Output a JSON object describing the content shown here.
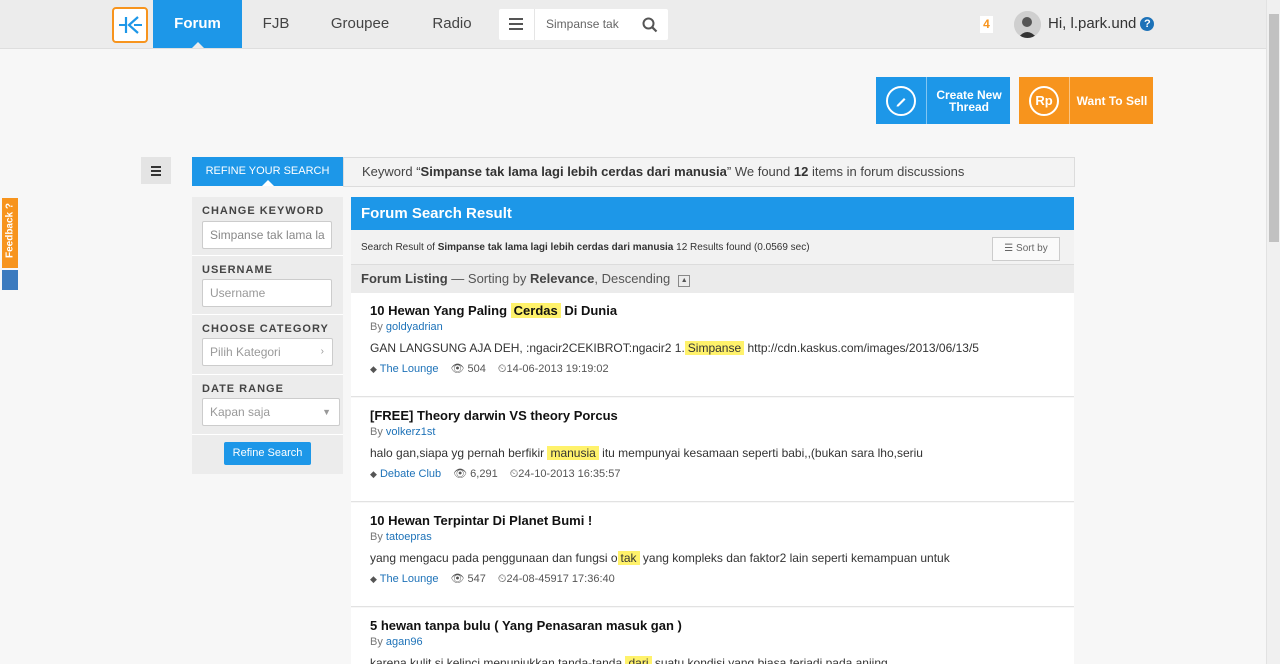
{
  "nav": {
    "tabs": [
      {
        "label": "Forum"
      },
      {
        "label": "FJB"
      },
      {
        "label": "Groupee"
      },
      {
        "label": "Radio"
      }
    ],
    "search_value": "Simpanse tak",
    "notification_count": "4",
    "greeting": "Hi, l.park.und"
  },
  "feedback": {
    "label": "Feedback ?"
  },
  "actions": {
    "create_thread": "Create New Thread",
    "want_to_sell": "Want To Sell",
    "sell_icon_text": "Rp"
  },
  "refine": {
    "tab_label": "REFINE YOUR SEARCH",
    "keyword_prefix": "Keyword “",
    "keyword": "Simpanse tak lama lagi lebih cerdas dari manusia",
    "keyword_mid": "” We found ",
    "count": "12",
    "keyword_suffix": " items in forum discussions"
  },
  "sidebar": {
    "change_keyword_label": "CHANGE KEYWORD",
    "change_keyword_value": "Simpanse tak lama la",
    "username_label": "USERNAME",
    "username_placeholder": "Username",
    "category_label": "CHOOSE CATEGORY",
    "category_placeholder": "Pilih Kategori",
    "date_label": "DATE RANGE",
    "date_value": "Kapan saja",
    "refine_button": "Refine Search"
  },
  "results": {
    "header": "Forum Search Result",
    "meta_prefix": "Search Result of ",
    "meta_query": "Simpanse tak lama lagi lebih cerdas dari manusia",
    "meta_suffix": " 12 Results found (0.0569 sec)",
    "sort_label": "Sort by",
    "listing_label": "Forum Listing",
    "listing_mid": " — Sorting by ",
    "listing_sort": "Relevance",
    "listing_order": ", Descending",
    "items": [
      {
        "title_pre": "10 Hewan Yang Paling ",
        "title_hl": "Cerdas",
        "title_post": " Di Dunia",
        "author_prefix": "By ",
        "author": "goldyadrian",
        "snippet_pre": "GAN LANGSUNG AJA DEH, :ngacir2CEKIBROT:ngacir2 1.",
        "snippet_hl": "Simpanse",
        "snippet_post": " http://cdn.kaskus.com/images/2013/06/13/5",
        "category": "The Lounge",
        "views": "504",
        "date": "14-06-2013 19:19:02"
      },
      {
        "title_pre": "[FREE] Theory darwin VS theory Porcus",
        "title_hl": "",
        "title_post": "",
        "author_prefix": "By ",
        "author": "volkerz1st",
        "snippet_pre": "halo gan,siapa yg pernah berfikir ",
        "snippet_hl": "manusia",
        "snippet_post": " itu mempunyai kesamaan seperti babi,,(bukan sara lho,seriu",
        "category": "Debate Club",
        "views": "6,291",
        "date": "24-10-2013 16:35:57"
      },
      {
        "title_pre": "10 Hewan Terpintar Di Planet Bumi !",
        "title_hl": "",
        "title_post": "",
        "author_prefix": "By ",
        "author": "tatoepras",
        "snippet_pre": "yang mengacu pada penggunaan dan fungsi o",
        "snippet_hl": "tak",
        "snippet_post": " yang kompleks dan faktor2 lain seperti kemampuan untuk",
        "category": "The Lounge",
        "views": "547",
        "date": "24-08-45917 17:36:40"
      },
      {
        "title_pre": "5 hewan tanpa bulu ( Yang Penasaran masuk gan )",
        "title_hl": "",
        "title_post": "",
        "author_prefix": "By ",
        "author": "agan96",
        "snippet_pre": "karena kulit si kelinci menunjukkan tanda-tanda ",
        "snippet_hl": "dari",
        "snippet_post": " suatu kondisi yang biasa terjadi pada anjing",
        "category": "",
        "views": "",
        "date": ""
      }
    ]
  }
}
